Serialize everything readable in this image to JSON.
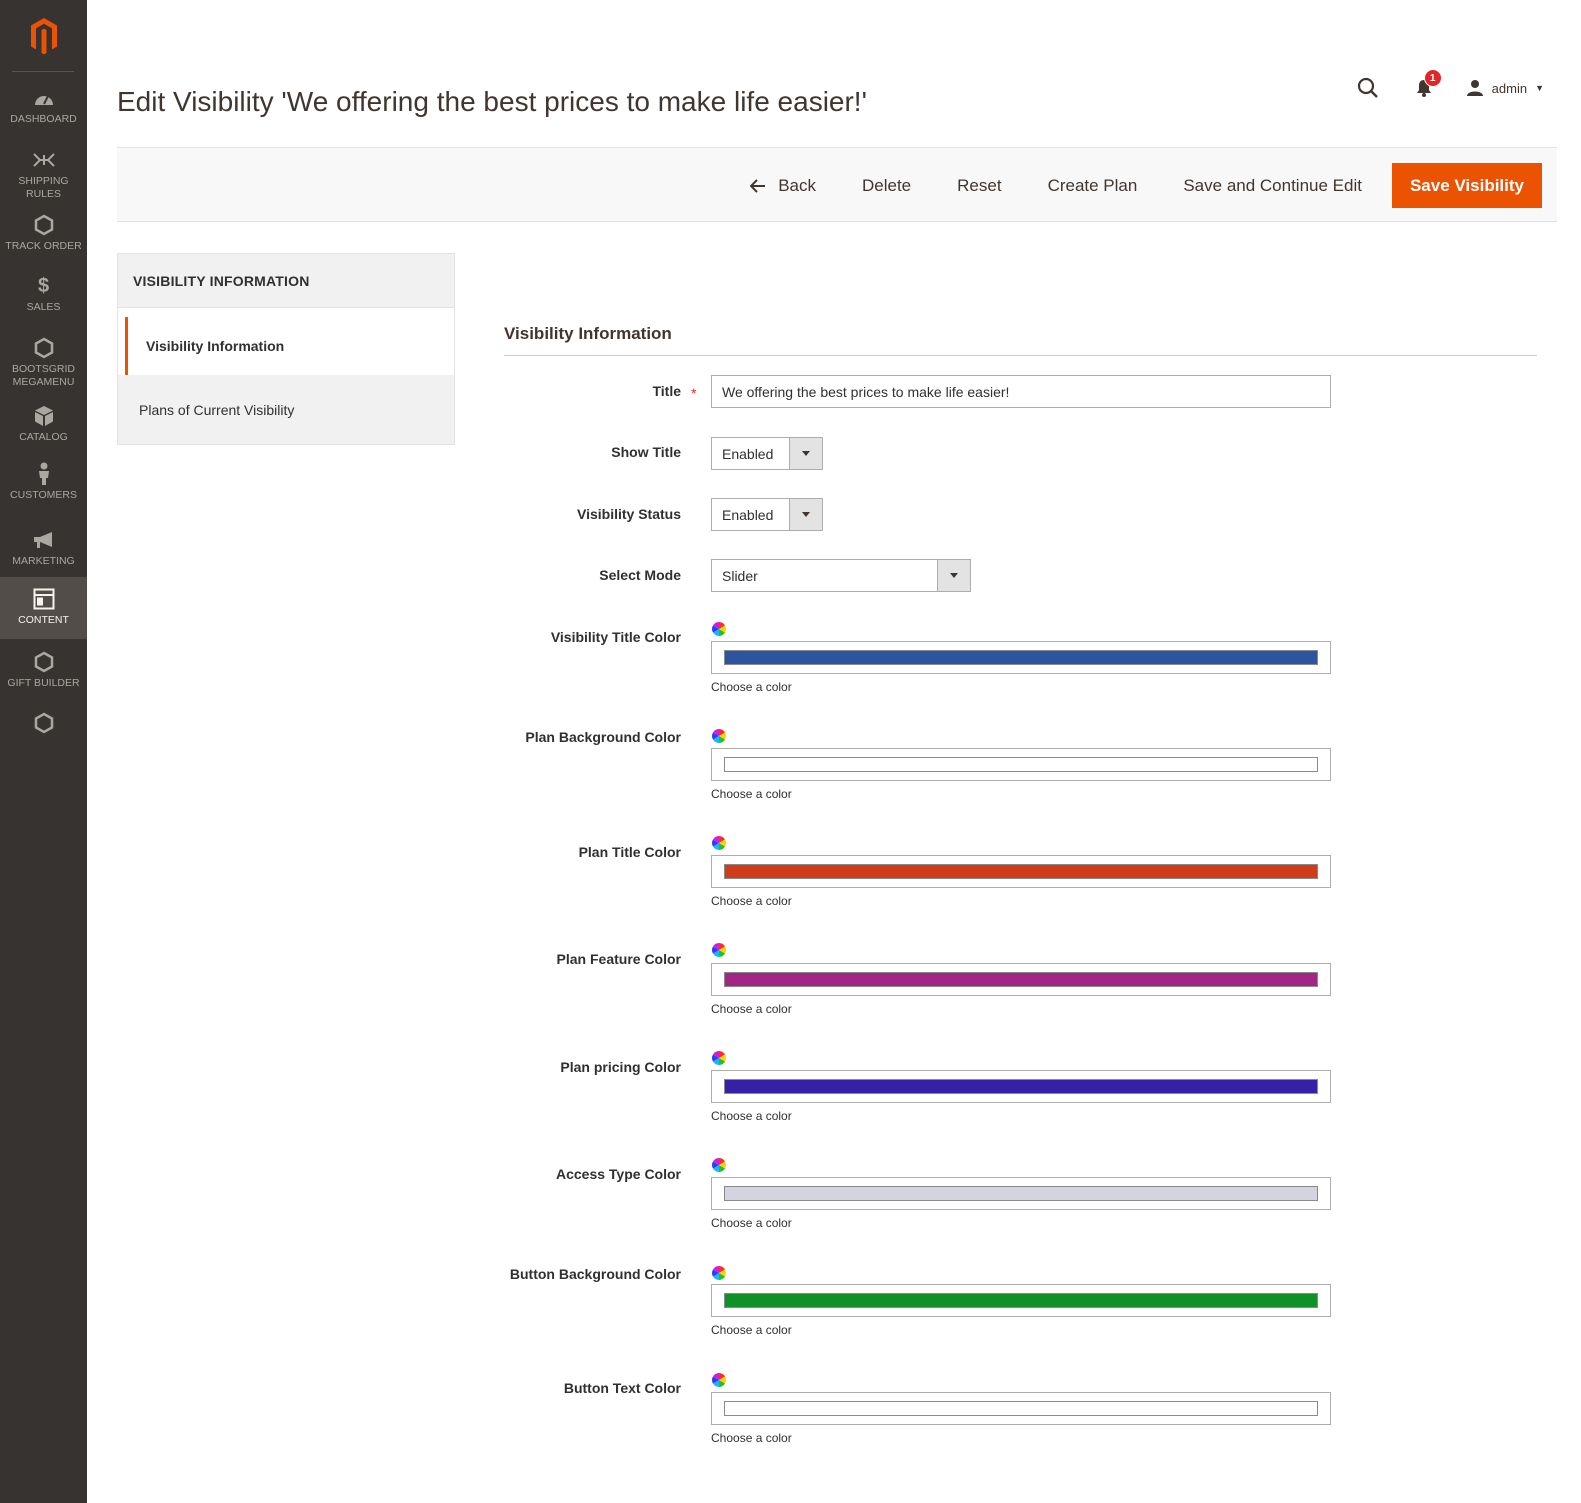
{
  "sidebar": {
    "items": [
      {
        "label": "Dashboard",
        "icon": "dashboard-icon"
      },
      {
        "label": "Shipping Rules",
        "icon": "shipping-icon"
      },
      {
        "label": "Track Order",
        "icon": "hexagon-icon"
      },
      {
        "label": "Sales",
        "icon": "dollar-icon"
      },
      {
        "label": "Bootsgrid Megamenu",
        "icon": "hexagon-icon"
      },
      {
        "label": "Catalog",
        "icon": "cube-icon"
      },
      {
        "label": "Customers",
        "icon": "person-icon"
      },
      {
        "label": "Marketing",
        "icon": "megaphone-icon"
      },
      {
        "label": "Content",
        "icon": "layout-icon",
        "active": true
      },
      {
        "label": "Gift Builder",
        "icon": "hexagon-icon"
      },
      {
        "label": "",
        "icon": "hexagon-icon"
      }
    ]
  },
  "header": {
    "title": "Edit Visibility 'We offering the best prices to make life easier!'",
    "notification_count": "1",
    "user": "admin"
  },
  "actions": {
    "back": "Back",
    "delete": "Delete",
    "reset": "Reset",
    "create_plan": "Create Plan",
    "save_continue": "Save and Continue Edit",
    "save": "Save Visibility"
  },
  "tabs": {
    "heading": "VISIBILITY INFORMATION",
    "items": [
      "Visibility Information",
      "Plans of Current Visibility"
    ]
  },
  "form": {
    "section_title": "Visibility Information",
    "title_label": "Title",
    "title_value": "We offering the best prices to make life easier!",
    "show_title_label": "Show Title",
    "show_title_value": "Enabled",
    "status_label": "Visibility Status",
    "status_value": "Enabled",
    "mode_label": "Select Mode",
    "mode_value": "Slider",
    "color_hint": "Choose a color",
    "colors": [
      {
        "label": "Visibility Title Color",
        "value": "#2c55a0"
      },
      {
        "label": "Plan Background Color",
        "value": "#ffffff"
      },
      {
        "label": "Plan Title Color",
        "value": "#d03c17"
      },
      {
        "label": "Plan Feature Color",
        "value": "#a32586"
      },
      {
        "label": "Plan pricing Color",
        "value": "#3620a6"
      },
      {
        "label": "Access Type Color",
        "value": "#d4d4e0"
      },
      {
        "label": "Button Background Color",
        "value": "#109127"
      },
      {
        "label": "Button Text Color",
        "value": "#ffffff"
      }
    ]
  },
  "colors": {
    "accent": "#eb5202",
    "sidebar_bg": "#373330"
  }
}
